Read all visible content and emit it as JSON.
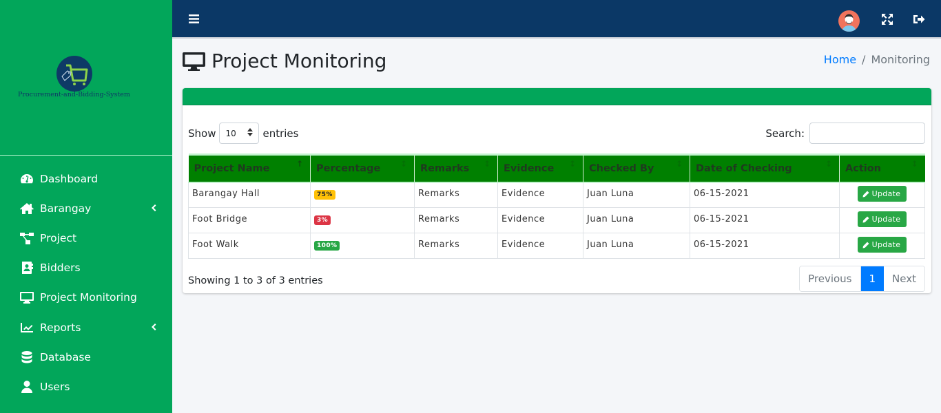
{
  "brand": {
    "logo_text": "Procurement-and-Bidding-System",
    "colors": {
      "sidebar": "#02a65a",
      "topbar": "#0b3866",
      "logo_circle": "#0e3a66",
      "logo_cart": "#8ed34a"
    }
  },
  "sidebar": {
    "items": [
      {
        "label": "Dashboard",
        "icon": "tachometer-icon",
        "has_caret": false
      },
      {
        "label": "Barangay",
        "icon": "home-icon",
        "has_caret": true
      },
      {
        "label": "Project",
        "icon": "sitemap-icon",
        "has_caret": false
      },
      {
        "label": "Bidders",
        "icon": "address-book-icon",
        "has_caret": false
      },
      {
        "label": "Project Monitoring",
        "icon": "desktop-icon",
        "has_caret": false
      },
      {
        "label": "Reports",
        "icon": "chart-line-icon",
        "has_caret": true
      },
      {
        "label": "Database",
        "icon": "database-icon",
        "has_caret": false
      },
      {
        "label": "Users",
        "icon": "user-icon",
        "has_caret": false
      }
    ]
  },
  "topbar": {
    "menu_icon": "bars-icon",
    "avatar_icon": "avatar",
    "fullscreen_icon": "expand-icon",
    "logout_icon": "sign-out-icon"
  },
  "header": {
    "title": "Project Monitoring",
    "icon": "desktop-icon",
    "breadcrumb": {
      "home": "Home",
      "separator": "/",
      "current": "Monitoring"
    }
  },
  "table_controls": {
    "show_label": "Show",
    "entries_label": "entries",
    "page_length": "10",
    "search_label": "Search:",
    "search_value": ""
  },
  "table": {
    "columns": [
      {
        "label": "Project Name",
        "sort": "↑"
      },
      {
        "label": "Percentage",
        "sort": "↕"
      },
      {
        "label": "Remarks",
        "sort": "↕"
      },
      {
        "label": "Evidence",
        "sort": "↕"
      },
      {
        "label": "Checked By",
        "sort": "↕"
      },
      {
        "label": "Date of Checking",
        "sort": "↕"
      },
      {
        "label": "Action",
        "sort": "↕"
      }
    ],
    "rows": [
      {
        "project_name": "Barangay Hall",
        "percentage": "75%",
        "badge_color": "#ffc107",
        "badge_text_color": "#212529",
        "remarks": "Remarks",
        "evidence": "Evidence",
        "checked_by": "Juan Luna",
        "date": "06-15-2021",
        "action": "Update"
      },
      {
        "project_name": "Foot Bridge",
        "percentage": "3%",
        "badge_color": "#dc3545",
        "badge_text_color": "#ffffff",
        "remarks": "Remarks",
        "evidence": "Evidence",
        "checked_by": "Juan Luna",
        "date": "06-15-2021",
        "action": "Update"
      },
      {
        "project_name": "Foot Walk",
        "percentage": "100%",
        "badge_color": "#28a745",
        "badge_text_color": "#ffffff",
        "remarks": "Remarks",
        "evidence": "Evidence",
        "checked_by": "Juan Luna",
        "date": "06-15-2021",
        "action": "Update"
      }
    ]
  },
  "footer": {
    "info": "Showing 1 to 3 of 3 entries",
    "pagination": {
      "previous": "Previous",
      "current": "1",
      "next": "Next"
    }
  }
}
